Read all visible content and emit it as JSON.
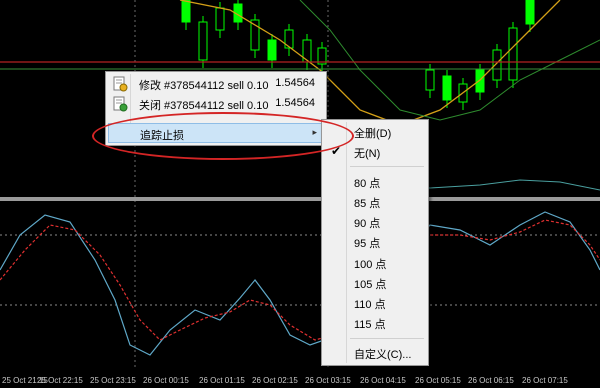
{
  "context_menu": {
    "items": [
      {
        "label": "修改 #378544112 sell 0.10",
        "price": "1.54564",
        "icon": "modify-order-icon"
      },
      {
        "label": "关闭 #378544112 sell 0.10",
        "price": "1.54564",
        "icon": "close-order-icon"
      },
      {
        "label": "追踪止损",
        "icon": "submenu-arrow-icon"
      }
    ]
  },
  "trailing_submenu": {
    "items": [
      {
        "label": "全删(D)",
        "checked": false
      },
      {
        "label": "无(N)",
        "checked": true
      },
      {
        "label": "80 点",
        "checked": false
      },
      {
        "label": "85 点",
        "checked": false
      },
      {
        "label": "90 点",
        "checked": false
      },
      {
        "label": "95 点",
        "checked": false
      },
      {
        "label": "100 点",
        "checked": false
      },
      {
        "label": "105 点",
        "checked": false
      },
      {
        "label": "110 点",
        "checked": false
      },
      {
        "label": "115 点",
        "checked": false
      },
      {
        "label": "自定义(C)...",
        "checked": false
      }
    ]
  },
  "x_axis": {
    "labels": [
      "25 Oct 21:15",
      "25 Oct 22:15",
      "25 Oct 23:15",
      "26 Oct 00:15",
      "26 Oct 01:15",
      "26 Oct 02:15",
      "26 Oct 03:15",
      "26 Oct 04:15",
      "26 Oct 05:15",
      "26 Oct 06:15",
      "26 Oct 07:15"
    ]
  },
  "colors": {
    "background": "#000000",
    "bull_candle": "#00ff00",
    "ma_orange": "#d4a017",
    "ma_green": "#2e8b2e",
    "price_line_red": "#b22222",
    "stoch_main": "#5fa8c8",
    "stoch_signal": "#e03030",
    "highlight_ellipse": "#d42525"
  }
}
